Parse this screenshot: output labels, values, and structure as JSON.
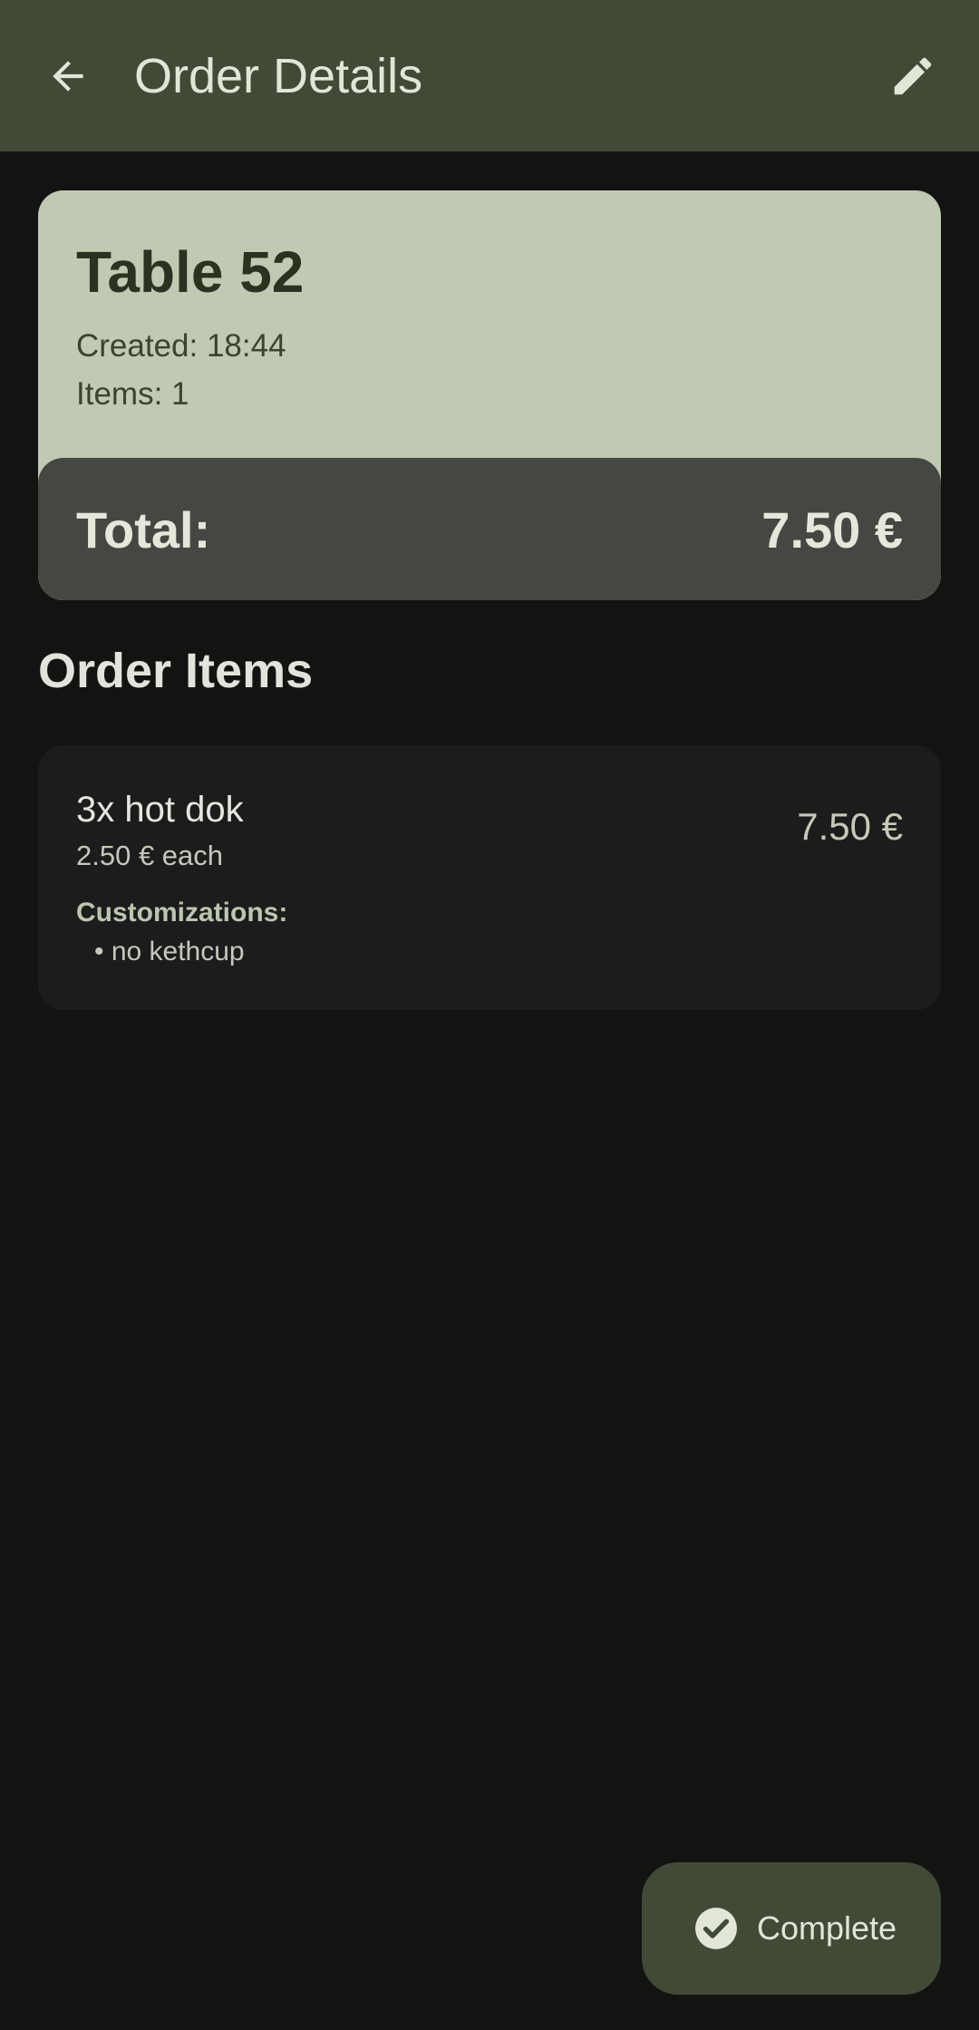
{
  "app_bar": {
    "title": "Order Details",
    "back_icon": "arrow-back-icon",
    "edit_icon": "pencil-edit-icon",
    "background_color": "#414a37"
  },
  "summary": {
    "table_name": "Table 52",
    "created": "Created: 18:44",
    "items": "Items: 1",
    "total_label": "Total:",
    "total_value": "7.50 €",
    "card_color": "#c0cab3",
    "total_bar_color": "#454842"
  },
  "order_items": {
    "section_title": "Order Items",
    "items": [
      {
        "name": "3x hot dok",
        "unit_price": "2.50 € each",
        "price": "7.50 €",
        "customizations_label": "Customizations:",
        "customizations": [
          "• no kethcup"
        ]
      }
    ]
  },
  "fab": {
    "label": "Complete",
    "icon": "check-circle-icon"
  }
}
